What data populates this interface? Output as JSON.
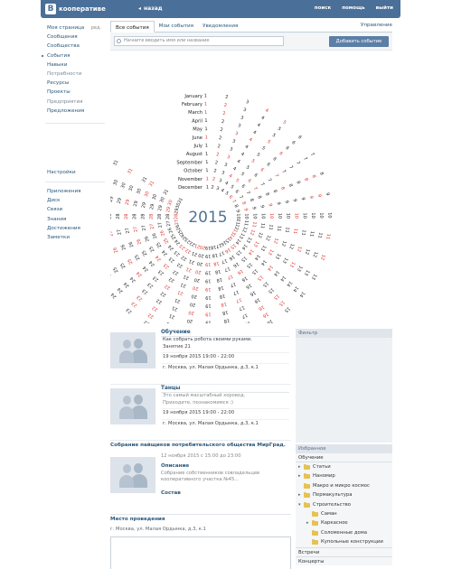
{
  "header": {
    "logo_letter": "В",
    "logo_text": "кооперативе",
    "back_label": "назад",
    "links": [
      "поиск",
      "помощь",
      "выйти"
    ]
  },
  "sidebar": {
    "edit_label": "ред.",
    "group1": [
      {
        "label": "Моя страница",
        "active": false,
        "muted": false
      },
      {
        "label": "Сообщения",
        "active": false,
        "muted": false
      },
      {
        "label": "Сообщества",
        "active": false,
        "muted": false
      },
      {
        "label": "События",
        "active": true,
        "muted": false
      },
      {
        "label": "Навыки",
        "active": false,
        "muted": false
      },
      {
        "label": "Потребности",
        "active": false,
        "muted": true
      },
      {
        "label": "Ресурсы",
        "active": false,
        "muted": false
      },
      {
        "label": "Проекты",
        "active": false,
        "muted": false
      },
      {
        "label": "Предприятия",
        "active": false,
        "muted": true
      },
      {
        "label": "Предложения",
        "active": false,
        "muted": false
      }
    ],
    "group2": [
      {
        "label": "Настройки"
      }
    ],
    "group3": [
      {
        "label": "Приложения"
      },
      {
        "label": "Диск"
      },
      {
        "label": "Связи"
      },
      {
        "label": "Знания"
      },
      {
        "label": "Достижения"
      },
      {
        "label": "Заметки"
      }
    ]
  },
  "main": {
    "tabs": [
      {
        "label": "Все события",
        "active": true
      },
      {
        "label": "Мои события",
        "active": false
      },
      {
        "label": "Уведомления",
        "active": false
      }
    ],
    "manage_label": "Управление",
    "search_placeholder": "Начните вводить имя или название",
    "add_button": "Добавить событие"
  },
  "calendar": {
    "year": "2015",
    "months": [
      "January",
      "February",
      "March",
      "April",
      "May",
      "June",
      "July",
      "August",
      "September",
      "October",
      "November",
      "December"
    ],
    "days_in_month": [
      31,
      28,
      31,
      30,
      31,
      30,
      31,
      31,
      30,
      31,
      30,
      31
    ],
    "first_weekday": [
      3,
      6,
      6,
      2,
      4,
      0,
      2,
      5,
      1,
      3,
      6,
      1
    ],
    "accent_color": "#d9322a",
    "text_color": "#222222",
    "year_color": "#4f7396"
  },
  "feed": {
    "events": [
      {
        "title": "Обучение",
        "lines": [
          "Как собрать робота своими руками.",
          "Занятие 21"
        ],
        "datetime": "19 ноября 2015   19:00 - 22:00",
        "address": "г. Москва, ул. Малая Ордынка, д.3, к.1"
      },
      {
        "title": "Танцы",
        "lines": [
          "Это самый масштабный хоровод.",
          "Приходите, познакомимся ;)"
        ],
        "datetime": "19 ноября 2015   19:00 - 22:00",
        "address": "г. Москва, ул. Малая Ордынка, д.3, к.1"
      }
    ],
    "meeting": {
      "title": "Собрание пайщиков потребительского общества  МирГрад.",
      "datetime": "12 ноября 2015 с 15:00 до 23:00",
      "desc_head": "Описание",
      "desc": "Собрание собственников совладельцев кооперативного участка №45...",
      "composition": "Состав"
    },
    "venue": {
      "heading": "Место проведения",
      "address": "г. Москва, ул. Малая Ордынка, д.3, к.1"
    }
  },
  "right": {
    "filter_label": "Фильтр",
    "favorites_label": "Избранное",
    "section_label": "Обучение",
    "categories": [
      {
        "label": "Статьи",
        "indent": 1,
        "twisty": "▸"
      },
      {
        "label": "Наномир",
        "indent": 1,
        "twisty": "▸"
      },
      {
        "label": "Макро и микро космос",
        "indent": 1,
        "twisty": ""
      },
      {
        "label": "Пермакультура",
        "indent": 1,
        "twisty": "▸"
      },
      {
        "label": "Строительство",
        "indent": 1,
        "twisty": "▾"
      },
      {
        "label": "Саман",
        "indent": 2,
        "twisty": ""
      },
      {
        "label": "Каркасное",
        "indent": 2,
        "twisty": "▸"
      },
      {
        "label": "Соломенные дома",
        "indent": 2,
        "twisty": ""
      },
      {
        "label": "Купольные конструкции",
        "indent": 2,
        "twisty": ""
      }
    ],
    "footer_items": [
      "Встречи",
      "Концерты"
    ]
  }
}
